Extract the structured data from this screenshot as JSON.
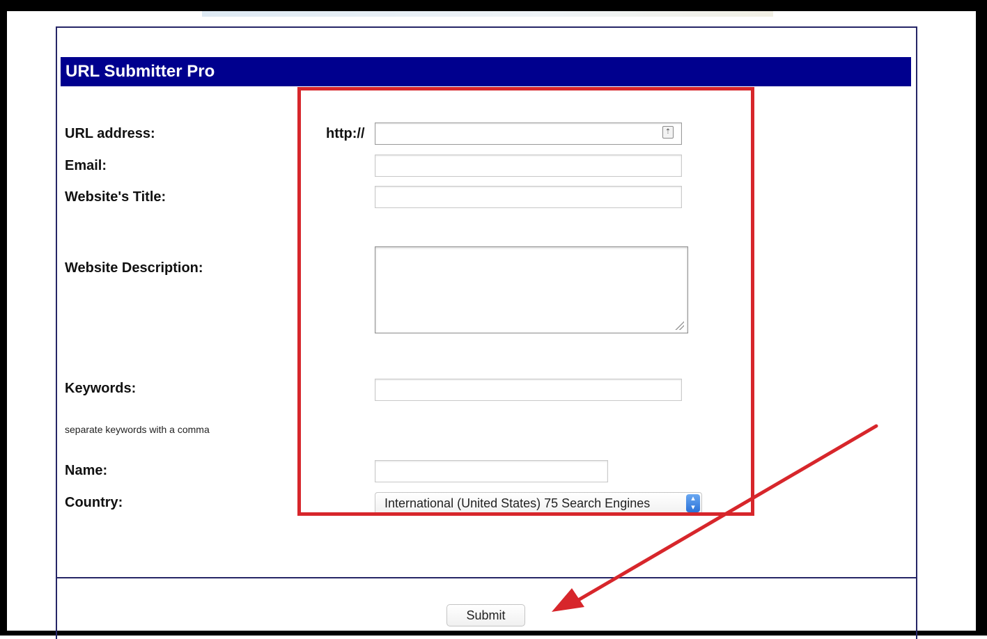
{
  "form": {
    "title": "URL Submitter Pro",
    "url_prefix": "http://",
    "fields": {
      "url": {
        "label": "URL address:",
        "value": ""
      },
      "email": {
        "label": "Email:",
        "value": ""
      },
      "title": {
        "label": "Website's Title:",
        "value": ""
      },
      "description": {
        "label": "Website Description:",
        "value": ""
      },
      "keywords": {
        "label": "Keywords:",
        "hint": "separate keywords with a comma",
        "value": ""
      },
      "name": {
        "label": "Name:",
        "value": ""
      },
      "country": {
        "label": "Country:",
        "selected": "International (United States) 75 Search Engines"
      }
    },
    "submit_label": "Submit"
  },
  "colors": {
    "title_bar": "#00008e",
    "panel_border": "#252566",
    "highlight": "#d7262b",
    "arrow": "#d7262b"
  },
  "annotations": {
    "highlight_box": "red-rectangle",
    "arrow_icon": "red-arrow-pointing-to-submit"
  }
}
